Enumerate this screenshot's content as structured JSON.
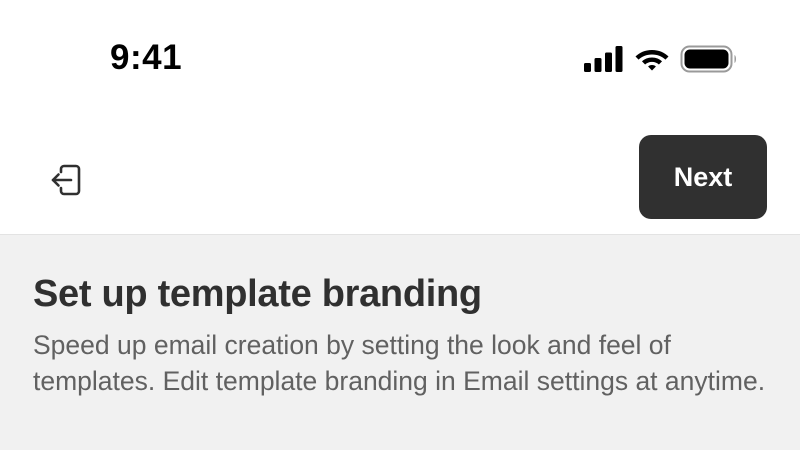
{
  "status_bar": {
    "time": "9:41",
    "icons": [
      "signal-icon",
      "wifi-icon",
      "battery-icon"
    ]
  },
  "top_bar": {
    "exit_icon": "exit-icon",
    "next_label": "Next"
  },
  "content": {
    "title": "Set up template branding",
    "description": "Speed up email creation by setting the look and feel of templates. Edit template branding in Email settings at anytime."
  },
  "colors": {
    "primary_button": "#303030",
    "section_background": "#f1f1f1",
    "description_text": "#616161"
  }
}
